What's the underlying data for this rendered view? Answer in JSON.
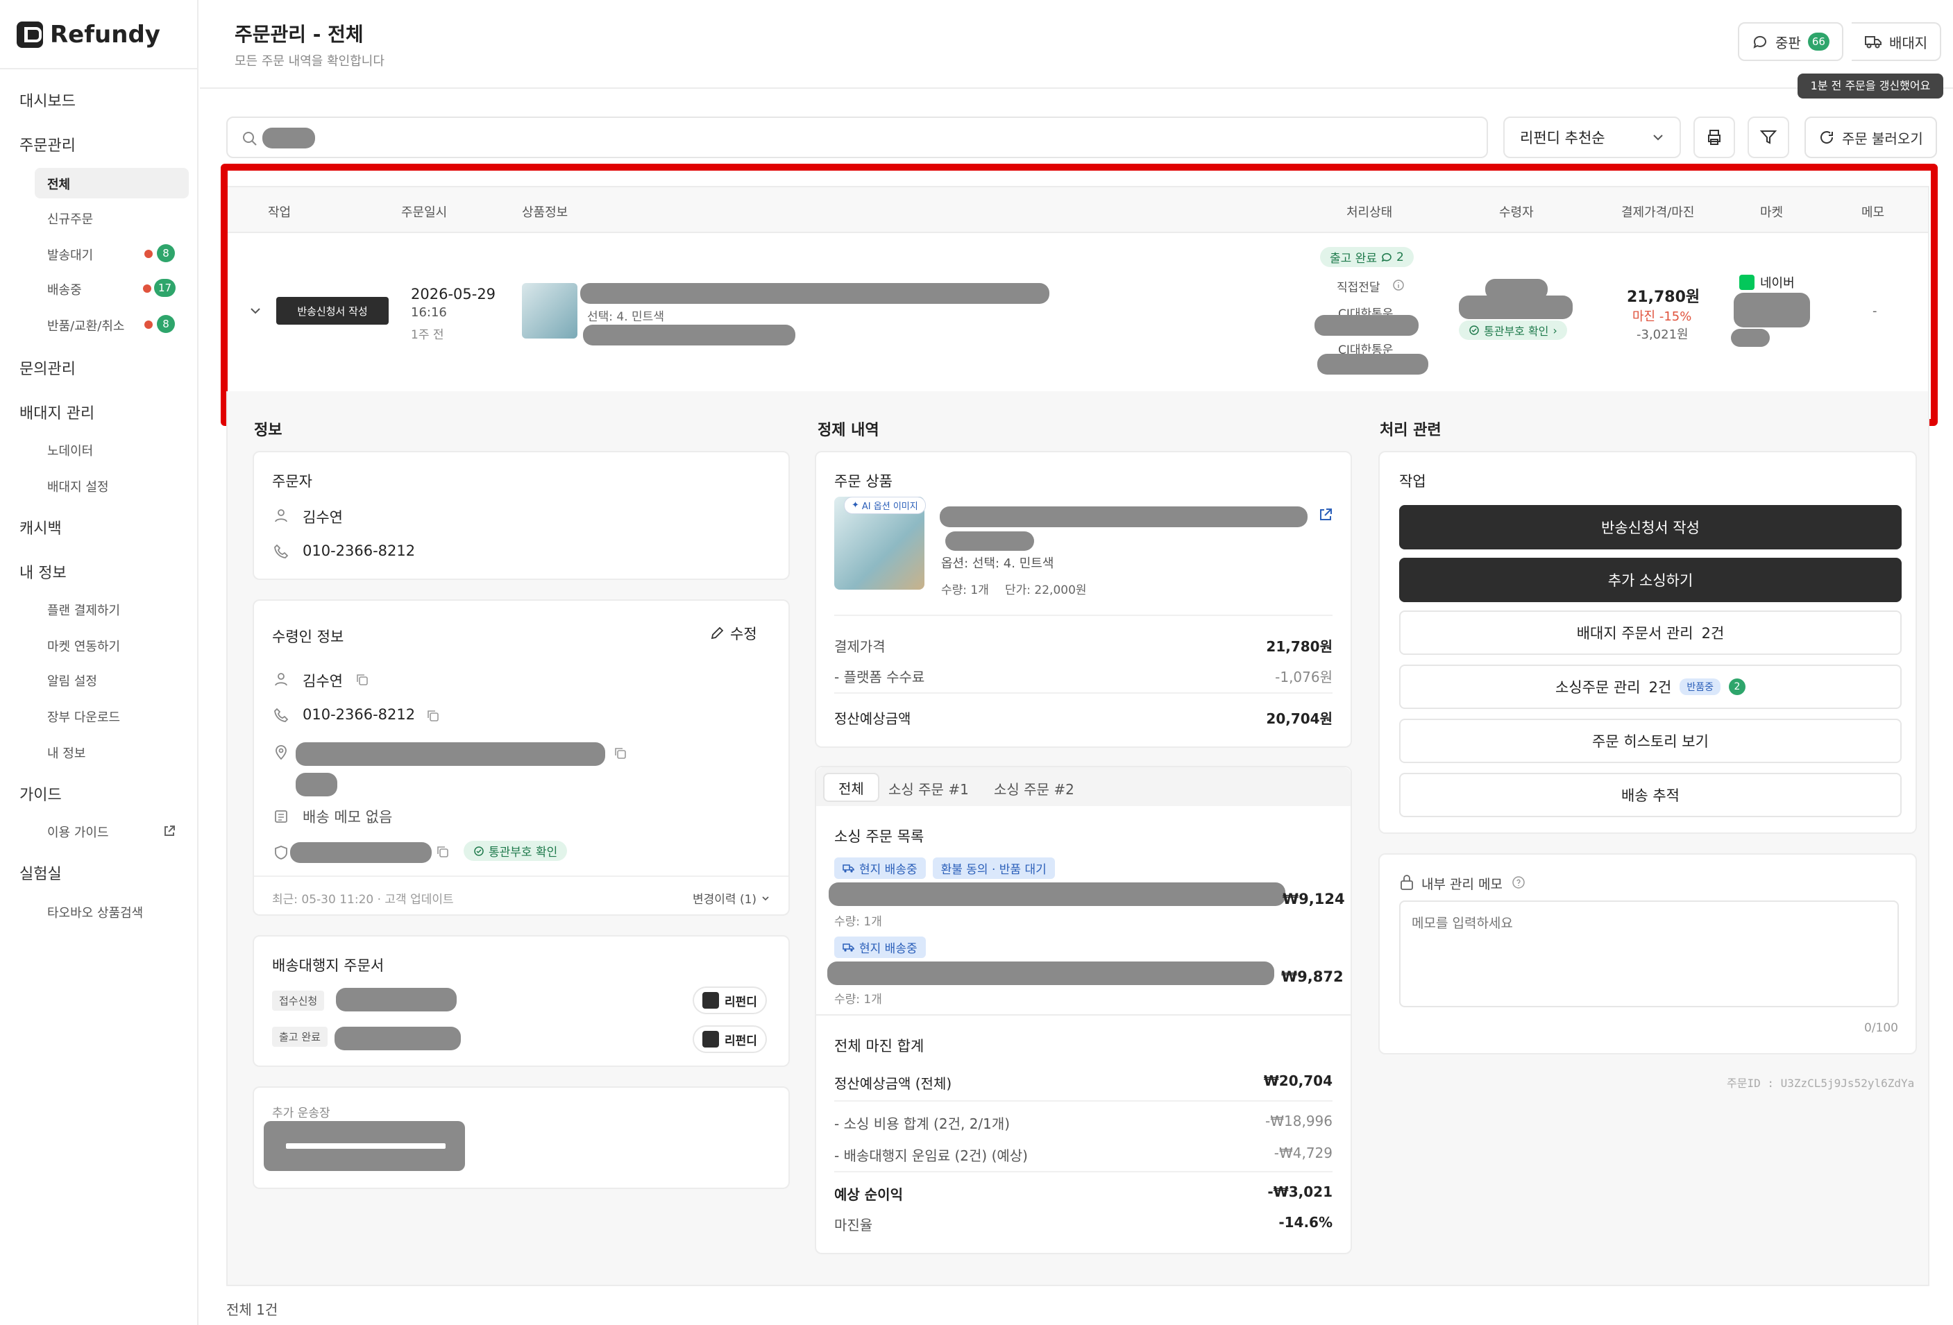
{
  "app": {
    "brand": "Refundy"
  },
  "sidebar": {
    "items": [
      {
        "label": "대시보드"
      },
      {
        "label": "주문관리"
      },
      {
        "label": "전체"
      },
      {
        "label": "신규주문"
      },
      {
        "label": "발송대기",
        "count": "8"
      },
      {
        "label": "배송중",
        "count": "17"
      },
      {
        "label": "반품/교환/취소",
        "count": "8"
      },
      {
        "label": "문의관리"
      },
      {
        "label": "배대지 관리"
      },
      {
        "label": "노데이터"
      },
      {
        "label": "배대지 설정"
      },
      {
        "label": "캐시백"
      },
      {
        "label": "내 정보"
      },
      {
        "label": "플랜 결제하기"
      },
      {
        "label": "마켓 연동하기"
      },
      {
        "label": "알림 설정"
      },
      {
        "label": "장부 다운로드"
      },
      {
        "label": "내 정보"
      },
      {
        "label": "가이드"
      },
      {
        "label": "이용 가이드"
      },
      {
        "label": "실험실"
      },
      {
        "label": "타오바오 상품검색"
      }
    ]
  },
  "header": {
    "title": "주문관리 - 전체",
    "subtitle": "모든 주문 내역을 확인합니다",
    "chat_label": "중판",
    "chat_count": "66",
    "forwarder_label": "배대지",
    "tooltip": "1분 전 주문을 갱신했어요"
  },
  "toolbar": {
    "select_value": "리펀디 추천순",
    "load_orders": "주문 불러오기"
  },
  "table": {
    "headers": [
      "작업",
      "주문일시",
      "상품정보",
      "처리상태",
      "수령자",
      "결제가격/마진",
      "마켓",
      "메모"
    ],
    "row": {
      "action": "반송신청서 작성",
      "date": "2026-05-29",
      "time": "16:16",
      "ago": "1주 전",
      "option": "선택: 4. 민트색",
      "status": "출고 완료",
      "status_comments": "2",
      "delivery": "직접전달",
      "courier1": "CJ대한통운",
      "courier2": "CJ대한통운",
      "customs": "통관부호 확인",
      "price": "21,780원",
      "margin": "마진 -15%",
      "margin_amount": "-3,021원",
      "market": "네이버",
      "memo": "-"
    }
  },
  "sections": {
    "left_title": "정보",
    "mid_title": "정제 내역",
    "right_title": "처리 관련"
  },
  "orderer": {
    "title": "주문자",
    "name": "김수연",
    "phone": "010-2366-8212"
  },
  "recipient": {
    "title": "수령인 정보",
    "edit": "수정",
    "name": "김수연",
    "phone": "010-2366-8212",
    "memo": "배송 메모 없음",
    "customs": "통관부호 확인",
    "updated": "최근: 05-30 11:20 · 고객 업데이트",
    "history": "변경이력 (1)"
  },
  "forwarder_orders": {
    "title": "배송대행지 주문서",
    "rows": [
      {
        "status": "접수신청",
        "brand": "리펀디"
      },
      {
        "status": "출고 완료",
        "brand": "리펀디"
      }
    ]
  },
  "extra_invoice": {
    "title": "추가 운송장"
  },
  "product": {
    "title": "주문 상품",
    "ai_badge": "AI 옵션 이미지",
    "option": "옵션: 선택: 4. 민트색",
    "qty": "수량: 1개",
    "unit_price": "단가: 22,000원"
  },
  "settlement": {
    "paid_label": "결제가격",
    "paid_value": "21,780원",
    "fee_label": "- 플랫폼 수수료",
    "fee_value": "-1,076원",
    "expected_label": "정산예상금액",
    "expected_value": "20,704원"
  },
  "sourcing": {
    "tabs": [
      "전체",
      "소싱 주문 #1",
      "소싱 주문 #2"
    ],
    "list_title": "소싱 주문 목록",
    "items": [
      {
        "tag1": "현지 배송중",
        "tag2": "환불 동의 · 반품 대기",
        "qty": "수량: 1개",
        "price": "₩9,124"
      },
      {
        "tag1": "현지 배송중",
        "qty": "수량: 1개",
        "price": "₩9,872"
      }
    ]
  },
  "margin_total": {
    "title": "전체 마진 합계",
    "rows": [
      {
        "label": "정산예상금액 (전체)",
        "value": "₩20,704"
      },
      {
        "label": "- 소싱 비용 합계 (2건, 2/1개)",
        "value": "-₩18,996"
      },
      {
        "label": "- 배송대행지 운임료 (2건) (예상)",
        "value": "-₩4,729"
      },
      {
        "label": "예상 순이익",
        "value": "-₩3,021"
      },
      {
        "label": "마진율",
        "value": "-14.6%"
      }
    ]
  },
  "actions": {
    "title": "작업",
    "return_form": "반송신청서 작성",
    "add_sourcing": "추가 소싱하기",
    "forwarder_manage": "배대지 주문서 관리",
    "forwarder_count": "2건",
    "sourcing_manage": "소싱주문 관리",
    "sourcing_count": "2건",
    "sourcing_badge": "반품중",
    "sourcing_badge_count": "2",
    "history": "주문 히스토리 보기",
    "tracking": "배송 추적"
  },
  "memo": {
    "title": "내부 관리 메모",
    "placeholder": "메모를 입력하세요",
    "counter": "0/100"
  },
  "order_id": "주문ID : U3ZzCL5j9Js52yl6ZdYa",
  "footer": {
    "total": "전체 1건"
  },
  "colors": {
    "accent_green": "#2ea56b",
    "danger": "#e0533d",
    "dark_button": "#2d2d2d",
    "highlight": "#e00000"
  }
}
